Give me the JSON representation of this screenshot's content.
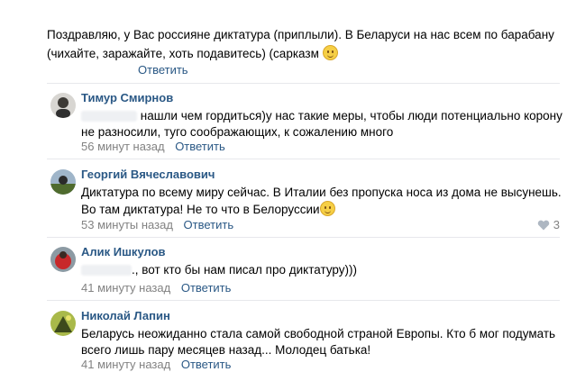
{
  "top_comment": {
    "text": "Поздравляю, у Вас россияне диктатура (приплыли). В Беларуси на нас всем по барабану (чихайте, заражайте, хоть подавитесь) (сарказм ",
    "reply": "Ответить",
    "emoji": "smile-emoji"
  },
  "comments": [
    {
      "author": "Тимур Смирнов",
      "text": "нашли чем гордиться)у нас такие меры, чтобы люди потенциально корону не разносили, туго соображающих, к сожалению много",
      "time": "56 минут назад",
      "reply": "Ответить",
      "avatar_color": "#4a4a4a"
    },
    {
      "author": "Георгий Вячеславович",
      "text": "Диктатура по всему миру сейчас. В Италии без пропуска носа из дома не высунешь. Во там диктатура! Не то что в Белоруссии",
      "time": "53 минуты назад",
      "reply": "Ответить",
      "likes": "3",
      "avatar_color": "#5d7a3a"
    },
    {
      "author": "Алик Ишкулов",
      "text": "., вот кто бы нам писал про диктатуру)))",
      "time": "41 минуту назад",
      "reply": "Ответить",
      "avatar_color": "#c0302a"
    },
    {
      "author": "Николай Лапин",
      "text": "Беларусь неожиданно стала самой свободной страной Европы. Кто б мог подумать всего лишь пару месяцев назад... Молодец батька!",
      "time": "41 минуту назад",
      "reply": "Ответить",
      "avatar_color": "#8fa23a"
    }
  ],
  "colors": {
    "link": "#2a5885",
    "meta": "#828282",
    "divider": "#e7e8ec"
  }
}
